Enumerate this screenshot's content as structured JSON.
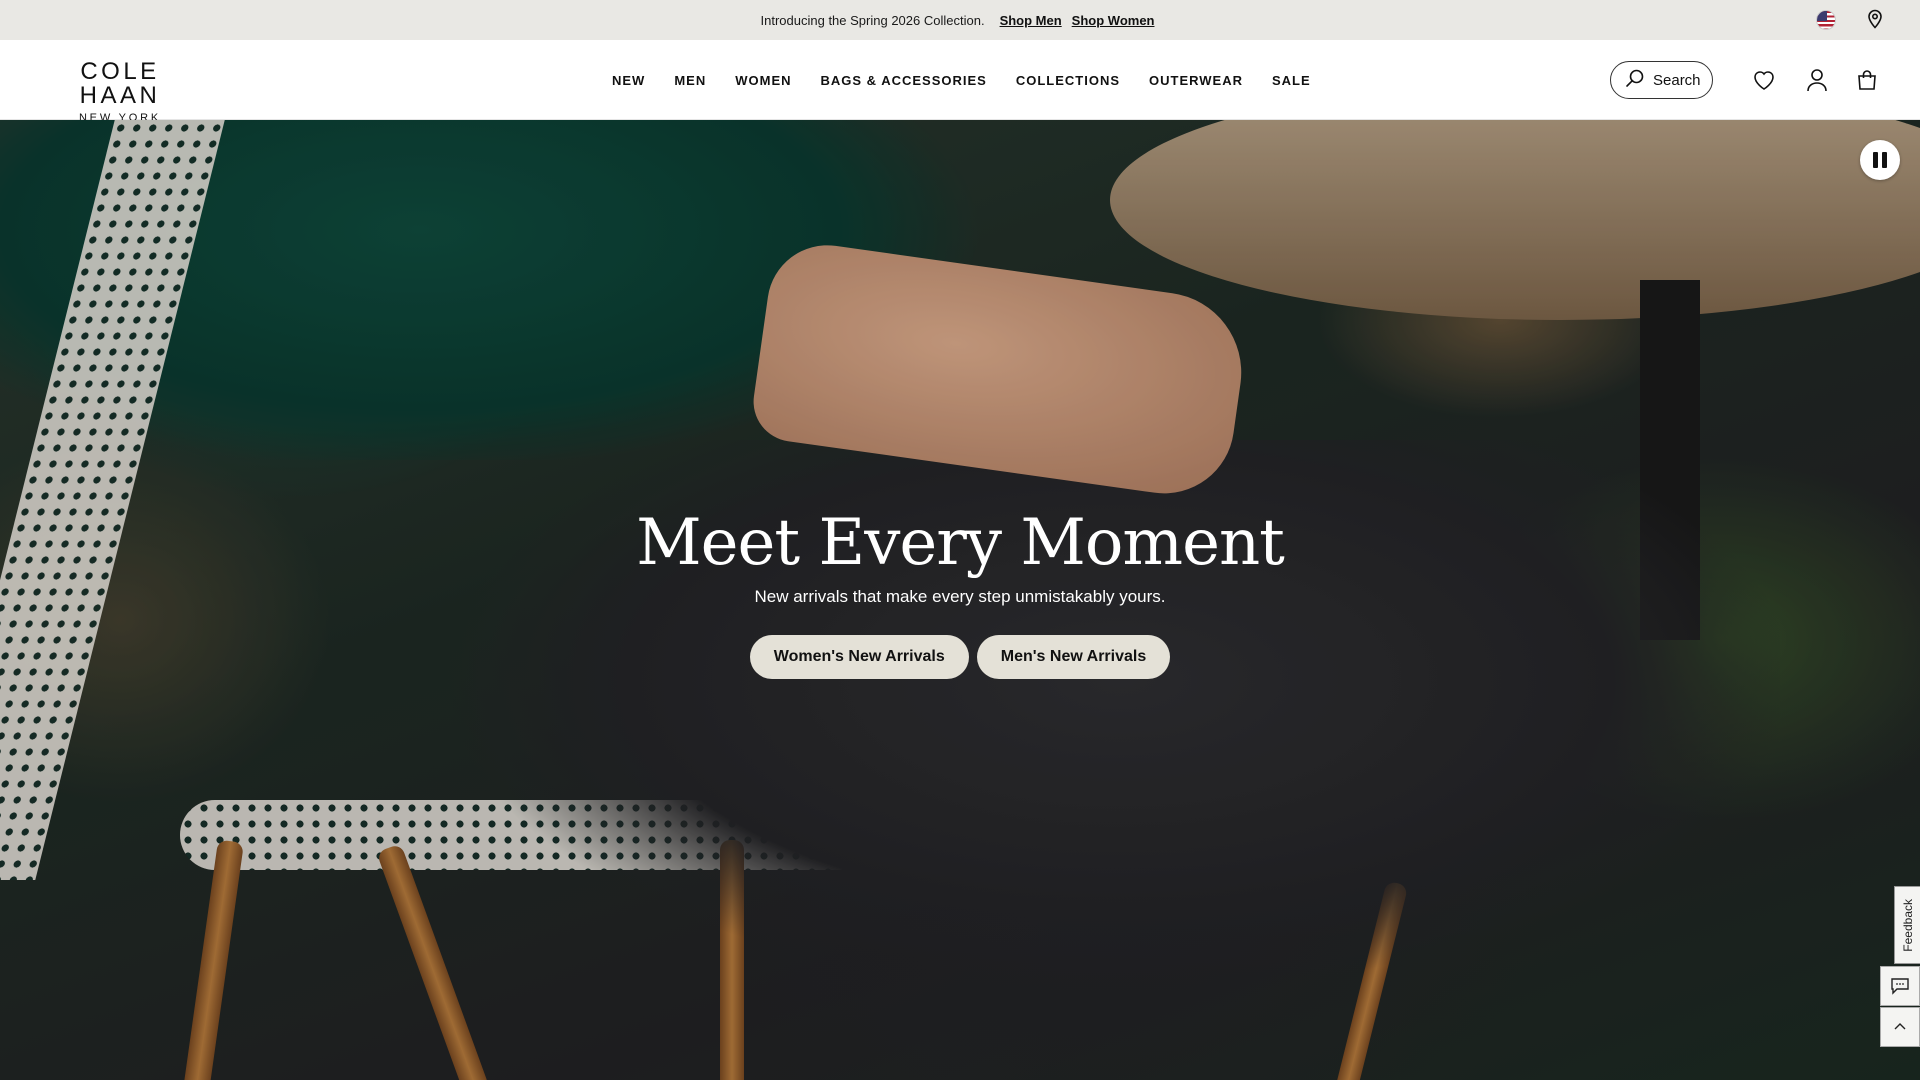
{
  "promo": {
    "text": "Introducing the Spring 2026 Collection.",
    "shop_men": "Shop Men",
    "shop_women": "Shop Women"
  },
  "header": {
    "logo_main": "COLE HAAN",
    "logo_sub": "NEW YORK",
    "nav": [
      "NEW",
      "MEN",
      "WOMEN",
      "BAGS & ACCESSORIES",
      "COLLECTIONS",
      "OUTERWEAR",
      "SALE"
    ],
    "search_label": "Search",
    "icons": [
      "us-flag-icon",
      "location-pin-icon",
      "search-icon",
      "heart-icon",
      "account-icon",
      "bag-icon"
    ]
  },
  "hero": {
    "title": "Meet Every Moment",
    "subtitle": "New arrivals that make every step unmistakably yours.",
    "cta_women": "Women's New Arrivals",
    "cta_men": "Men's New Arrivals"
  },
  "widgets": {
    "feedback_label": "Feedback"
  },
  "colors": {
    "promo_bg": "#e9e8e4",
    "cta_bg": "#e4e1d7",
    "sweater_green": "#0e463a"
  }
}
